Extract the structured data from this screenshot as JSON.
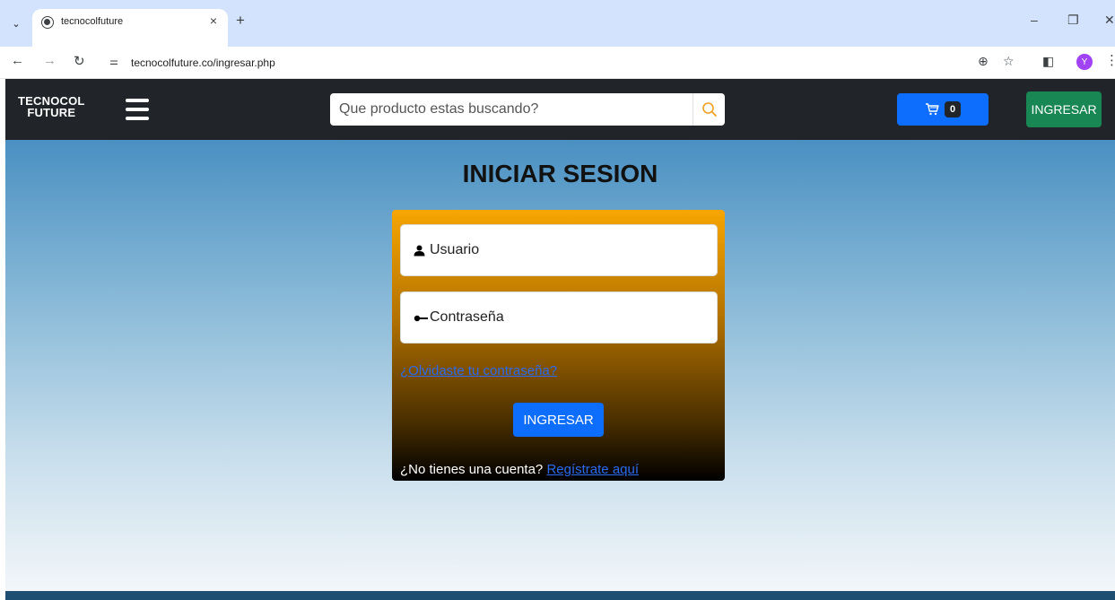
{
  "browser": {
    "tab_title": "tecnocolfuture",
    "tab_close": "×",
    "new_tab": "+",
    "url": "tecnocolfuture.co/ingresar.php",
    "profile_initial": "Y",
    "icons": [
      "tab-list-icon",
      "globe-icon",
      "back-icon",
      "forward-icon",
      "reload-icon",
      "site-settings-icon",
      "zoom-icon",
      "star-icon",
      "side-panel-icon",
      "menu-icon"
    ]
  },
  "header": {
    "logo_line1": "TECNOCOL",
    "logo_line2": "FUTURE",
    "search_placeholder": "Que producto estas buscando?",
    "cart_count": "0",
    "login_button": "INGRESAR"
  },
  "main": {
    "title": "INICIAR SESION",
    "user_placeholder": "Usuario",
    "password_placeholder": "Contraseña",
    "forgot_link": "¿Olvidaste tu contraseña?",
    "submit_label": "INGRESAR",
    "no_account_text": "¿No tienes una cuenta?",
    "register_link": "Regístrate aquí"
  },
  "colors": {
    "header_bg": "#212529",
    "cart_bg": "#0d6efd",
    "login_bg": "#198754",
    "card_top": "#f7a600",
    "card_bottom": "#000000",
    "search_icon": "#f0a020"
  }
}
